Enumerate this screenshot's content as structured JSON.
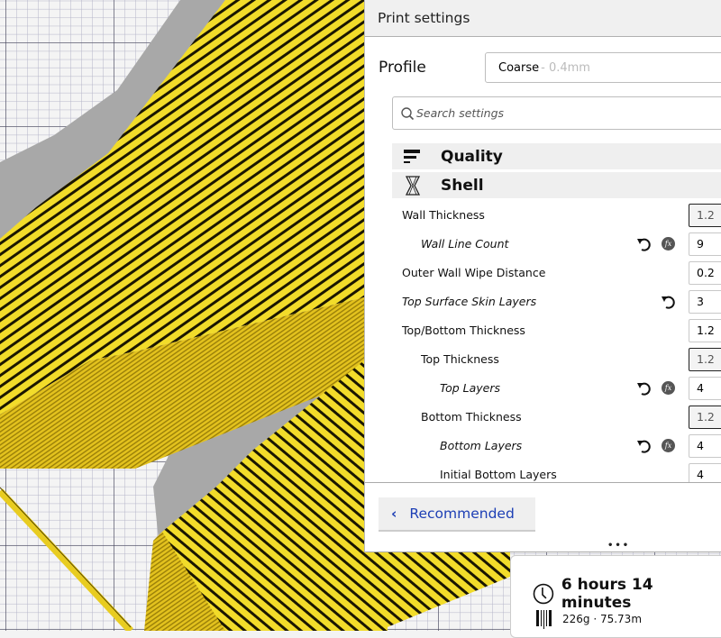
{
  "panel": {
    "title": "Print settings",
    "profile_label": "Profile",
    "profile_value": "Coarse",
    "profile_sub": " - 0.4mm",
    "search_placeholder": "Search settings",
    "categories": [
      {
        "label": "Quality",
        "icon": "quality-icon"
      },
      {
        "label": "Shell",
        "icon": "shell-icon"
      }
    ],
    "settings": [
      {
        "label": "Wall Thickness",
        "value": "1.2",
        "indent": 0,
        "italic": false,
        "reset": false,
        "fx": false,
        "readonly": true
      },
      {
        "label": "Wall Line Count",
        "value": "9",
        "indent": 1,
        "italic": true,
        "reset": true,
        "fx": true,
        "readonly": false
      },
      {
        "label": "Outer Wall Wipe Distance",
        "value": "0.2",
        "indent": 0,
        "italic": false,
        "reset": false,
        "fx": false,
        "readonly": false
      },
      {
        "label": "Top Surface Skin Layers",
        "value": "3",
        "indent": 0,
        "italic": true,
        "reset": true,
        "fx": false,
        "readonly": false
      },
      {
        "label": "Top/Bottom Thickness",
        "value": "1.2",
        "indent": 0,
        "italic": false,
        "reset": false,
        "fx": false,
        "readonly": false
      },
      {
        "label": "Top Thickness",
        "value": "1.2",
        "indent": 1,
        "italic": false,
        "reset": false,
        "fx": false,
        "readonly": true
      },
      {
        "label": "Top Layers",
        "value": "4",
        "indent": 2,
        "italic": true,
        "reset": true,
        "fx": true,
        "readonly": false
      },
      {
        "label": "Bottom Thickness",
        "value": "1.2",
        "indent": 1,
        "italic": false,
        "reset": false,
        "fx": false,
        "readonly": true
      },
      {
        "label": "Bottom Layers",
        "value": "4",
        "indent": 2,
        "italic": true,
        "reset": true,
        "fx": true,
        "readonly": false
      },
      {
        "label": "Initial Bottom Layers",
        "value": "4",
        "indent": 2,
        "italic": false,
        "reset": false,
        "fx": false,
        "readonly": false
      }
    ],
    "fx_label": "fx",
    "recommended_label": "Recommended",
    "drag_handle": "•••"
  },
  "summary": {
    "print_time": "6 hours 14 minutes",
    "material": "226g · 75.73m"
  },
  "colors": {
    "filament": "#f7e531",
    "accent_link": "#1d3fb5",
    "shadow": "#a8a8a8"
  }
}
